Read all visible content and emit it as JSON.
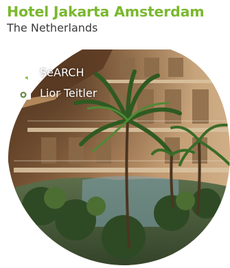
{
  "title": "Hotel Jakarta Amsterdam",
  "subtitle": "The Netherlands",
  "colors": {
    "title": "#7ab82e",
    "pencil_icon": "#7ab82e",
    "camera_icon": "#ffffff",
    "credit_text": "#ffffff"
  },
  "credits": {
    "architect": {
      "icon": "pencil-icon",
      "label": "SeARCH"
    },
    "photographer": {
      "icon": "camera-icon",
      "label": "Lior Teitler"
    }
  }
}
